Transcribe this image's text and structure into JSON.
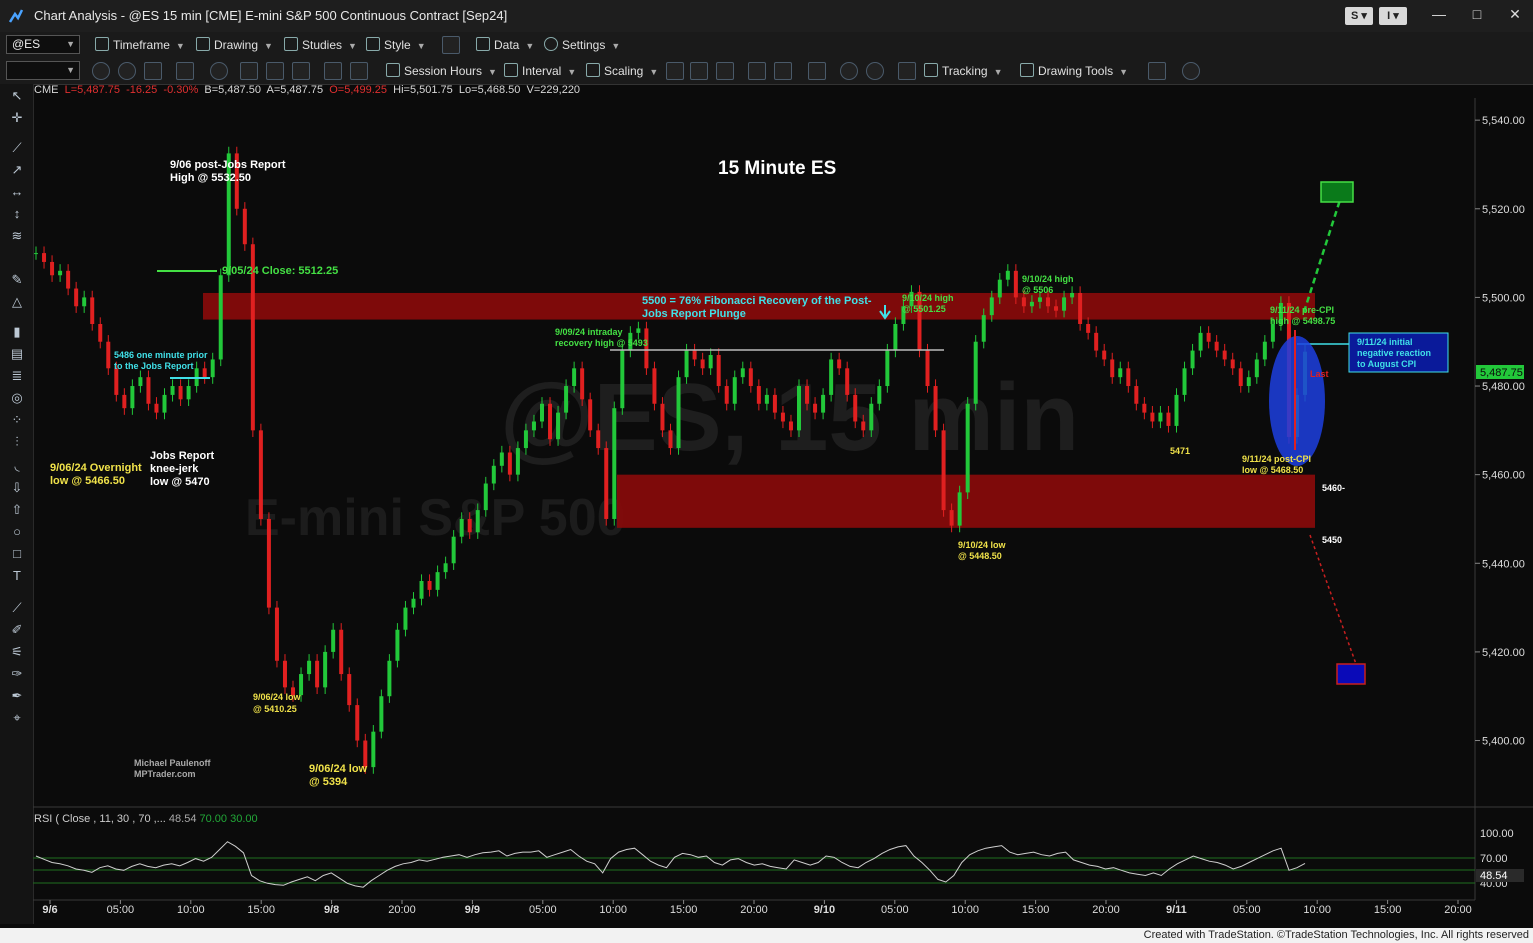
{
  "window": {
    "title": "Chart Analysis - @ES 15 min [CME] E-mini S&P 500 Continuous Contract [Sep24]",
    "btn_s": "S",
    "btn_i": "I",
    "minimize": "—",
    "maximize": "□",
    "close": "✕"
  },
  "toolbar1": {
    "symbol": "@ES",
    "timeframe": "Timeframe",
    "drawing": "Drawing",
    "studies": "Studies",
    "style": "Style",
    "data": "Data",
    "settings": "Settings"
  },
  "toolbar2": {
    "session_hours": "Session Hours",
    "interval": "Interval",
    "scaling": "Scaling",
    "tracking": "Tracking",
    "drawing_tools": "Drawing Tools"
  },
  "quote": {
    "exchange": "CME",
    "last": "L=5,487.75",
    "change": "-16.25",
    "pct": "-0.30%",
    "bid": "B=5,487.50",
    "ask": "A=5,487.75",
    "open": "O=5,499.25",
    "hi": "Hi=5,501.75",
    "lo": "Lo=5,468.50",
    "vol": "V=229,220"
  },
  "watermark": {
    "big": "@ES, 15 min",
    "small": "E-mini S&P 500"
  },
  "chart_data": {
    "type": "line",
    "title": "15 Minute ES",
    "ylim": [
      5385,
      5545
    ],
    "y_ticks": [
      "5,540.00",
      "5,520.00",
      "5,500.00",
      "5,480.00",
      "5,460.00",
      "5,440.00",
      "5,420.00",
      "5,400.00"
    ],
    "x_ticks": [
      "9/6",
      "05:00",
      "10:00",
      "15:00",
      "9/8",
      "20:00",
      "9/9",
      "05:00",
      "10:00",
      "15:00",
      "20:00",
      "9/10",
      "05:00",
      "10:00",
      "15:00",
      "20:00",
      "9/11",
      "05:00",
      "10:00",
      "15:00",
      "20:00"
    ],
    "last_price_label": "5,487.75",
    "series": [
      {
        "values": [
          5510,
          5508,
          5505,
          5506,
          5502,
          5498,
          5500,
          5494,
          5490,
          5484,
          5478,
          5475,
          5480,
          5482,
          5476,
          5474,
          5478,
          5480,
          5477,
          5480,
          5484,
          5482,
          5486,
          5505,
          5532.5,
          5520,
          5512,
          5470,
          5450,
          5430,
          5418,
          5412,
          5410.25,
          5415,
          5418,
          5412,
          5420,
          5425,
          5415,
          5408,
          5400,
          5394,
          5402,
          5410,
          5418,
          5425,
          5430,
          5432,
          5436,
          5434,
          5438,
          5440,
          5446,
          5450,
          5447,
          5452,
          5458,
          5462,
          5465,
          5460,
          5466,
          5470,
          5472,
          5476,
          5468,
          5474,
          5480,
          5484,
          5477,
          5470,
          5466,
          5450,
          5475,
          5488,
          5492,
          5493,
          5484,
          5476,
          5470,
          5466,
          5482,
          5488,
          5486,
          5484,
          5487,
          5480,
          5476,
          5482,
          5484,
          5480,
          5476,
          5478,
          5474,
          5472,
          5470,
          5480,
          5476,
          5474,
          5478,
          5486,
          5484,
          5478,
          5472,
          5470,
          5476,
          5480,
          5488,
          5494,
          5498,
          5501.25,
          5488,
          5480,
          5470,
          5452,
          5448.5,
          5456,
          5476,
          5490,
          5496,
          5500,
          5504,
          5506,
          5500,
          5498,
          5499,
          5500,
          5498,
          5497,
          5500,
          5501,
          5494,
          5492,
          5488,
          5486,
          5482,
          5484,
          5480,
          5476,
          5474,
          5472,
          5474,
          5471,
          5478,
          5484,
          5488,
          5492,
          5490,
          5488,
          5486,
          5484,
          5480,
          5482,
          5486,
          5490,
          5494,
          5498.75,
          5468.5,
          5478,
          5487.75
        ]
      }
    ],
    "rsi": {
      "legend": "RSI ( Close , 11, 30 , 70 ,...",
      "value": "48.54",
      "overbought": "70.00",
      "oversold": "30.00",
      "ticks": [
        "100.00",
        "70.00",
        "40.00"
      ],
      "value_badge": "48.54",
      "values": [
        60,
        55,
        50,
        48,
        45,
        40,
        38,
        35,
        42,
        45,
        40,
        38,
        44,
        48,
        44,
        42,
        46,
        48,
        45,
        50,
        56,
        52,
        58,
        70,
        82,
        75,
        65,
        30,
        22,
        18,
        16,
        15,
        20,
        24,
        28,
        22,
        30,
        34,
        26,
        18,
        14,
        12,
        22,
        30,
        38,
        44,
        48,
        50,
        54,
        52,
        55,
        58,
        60,
        62,
        58,
        62,
        65,
        66,
        68,
        60,
        64,
        66,
        66,
        68,
        58,
        62,
        66,
        70,
        60,
        52,
        48,
        34,
        56,
        66,
        70,
        72,
        62,
        52,
        46,
        42,
        58,
        64,
        62,
        58,
        60,
        50,
        46,
        54,
        56,
        50,
        46,
        48,
        44,
        42,
        40,
        54,
        50,
        46,
        50,
        60,
        58,
        50,
        44,
        42,
        50,
        56,
        64,
        70,
        74,
        76,
        60,
        50,
        38,
        24,
        20,
        30,
        50,
        62,
        68,
        72,
        74,
        76,
        66,
        62,
        64,
        66,
        62,
        60,
        64,
        66,
        54,
        50,
        46,
        44,
        40,
        42,
        38,
        34,
        32,
        30,
        34,
        30,
        40,
        48,
        54,
        60,
        56,
        52,
        50,
        46,
        40,
        44,
        50,
        56,
        62,
        68,
        72,
        38,
        42,
        48.54
      ]
    },
    "annotations": [
      "9/06 post-Jobs Report",
      "High @ 5532.50",
      "9/05/24 Close: 5512.25",
      "5486 one minute prior",
      "to the Jobs Report",
      "9/06/24 Overnight",
      "low @ 5466.50",
      "Jobs Report",
      "knee-jerk",
      "low @ 5470",
      "9/06/24 low",
      "@ 5410.25",
      "9/06/24 low",
      "@ 5394",
      "5500 = 76% Fibonacci Recovery of the Post-",
      "Jobs Report Plunge",
      "9/09/24 intraday",
      "recovery high @ 5493",
      "9/10/24 high",
      "@ 5501.25",
      "9/10/24 high",
      "@ 5506",
      "9/10/24 low",
      "@ 5448.50",
      "5471",
      "9/11/24 pre-CPI",
      "high @ 5498.75",
      "9/11/24 initial",
      "negative reaction",
      "to August CPI",
      "9/11/24 post-CPI",
      "low @ 5468.50",
      "Last",
      "5460-",
      "5450",
      "Michael Paulenoff",
      "MPTrader.com"
    ],
    "zones": [
      {
        "from": 5495,
        "to": 5501
      },
      {
        "from": 5448,
        "to": 5460
      }
    ]
  },
  "footer": "Created with TradeStation. ©TradeStation Technologies, Inc. All rights reserved",
  "colors": {
    "bull": "#22c83a",
    "bear": "#e02020",
    "zone": "#8b0a0a",
    "annotation_yellow": "#f0e24a",
    "annotation_green": "#44e044",
    "annotation_cyan": "#40e0e8"
  }
}
